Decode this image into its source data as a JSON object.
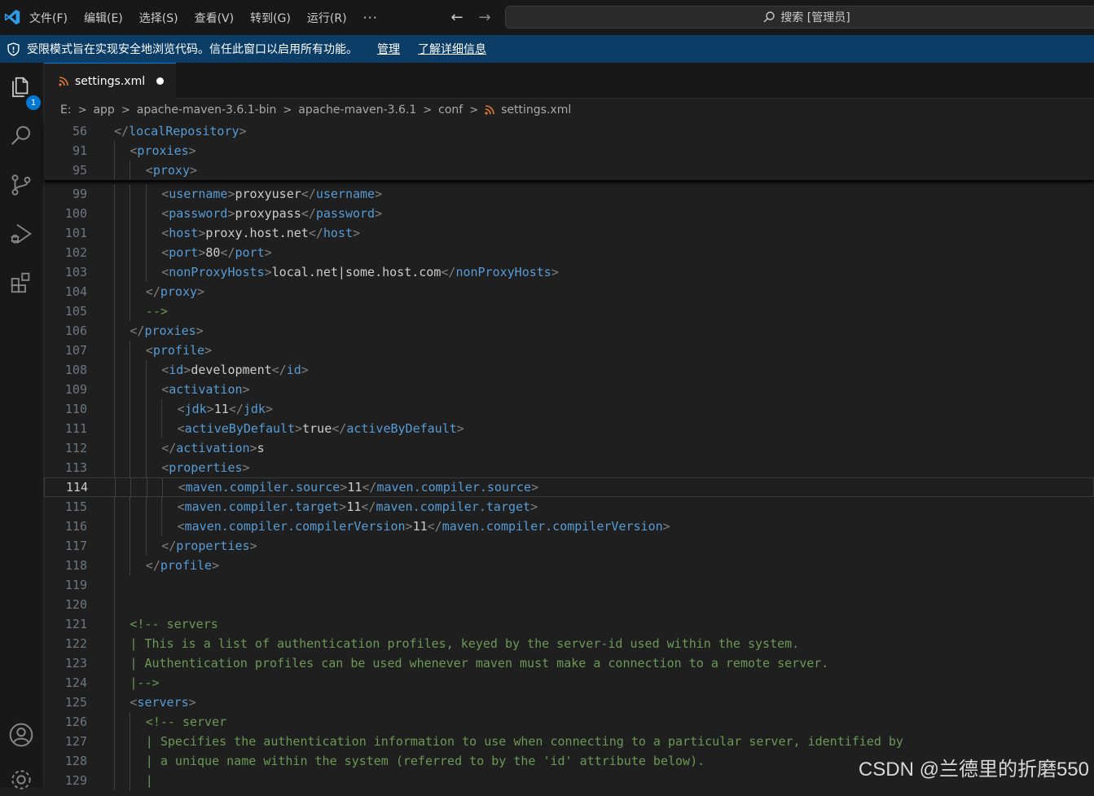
{
  "menu": [
    "文件(F)",
    "编辑(E)",
    "选择(S)",
    "查看(V)",
    "转到(G)",
    "运行(R)",
    "···"
  ],
  "search": {
    "label": "搜索 [管理员]"
  },
  "banner": {
    "text": "受限模式旨在实现安全地浏览代码。信任此窗口以启用所有功能。",
    "manage": "管理",
    "learn_more": "了解详细信息"
  },
  "activity": {
    "explorer_badge": "1"
  },
  "tab": {
    "name": "settings.xml"
  },
  "breadcrumb": [
    "E:",
    "app",
    "apache-maven-3.6.1-bin",
    "apache-maven-3.6.1",
    "conf",
    "settings.xml"
  ],
  "sticky_lines": [
    {
      "n": "56",
      "code": "</localRepository>"
    },
    {
      "n": "91",
      "code": "<proxies>"
    },
    {
      "n": "95",
      "code": "<proxy>"
    }
  ],
  "lines": [
    {
      "n": "99",
      "code": "<username>proxyuser</username>"
    },
    {
      "n": "100",
      "code": "<password>proxypass</password>"
    },
    {
      "n": "101",
      "code": "<host>proxy.host.net</host>"
    },
    {
      "n": "102",
      "code": "<port>80</port>"
    },
    {
      "n": "103",
      "code": "<nonProxyHosts>local.net|some.host.com</nonProxyHosts>"
    },
    {
      "n": "104",
      "code": "</proxy>"
    },
    {
      "n": "105",
      "code": "-->"
    },
    {
      "n": "106",
      "code": "</proxies>"
    },
    {
      "n": "107",
      "code": "<profile>"
    },
    {
      "n": "108",
      "code": "<id>development</id>"
    },
    {
      "n": "109",
      "code": "<activation>"
    },
    {
      "n": "110",
      "code": "<jdk>11</jdk>"
    },
    {
      "n": "111",
      "code": "<activeByDefault>true</activeByDefault>"
    },
    {
      "n": "112",
      "code": "</activation>s"
    },
    {
      "n": "113",
      "code": "<properties>"
    },
    {
      "n": "114",
      "code": "<maven.compiler.source>11</maven.compiler.source>"
    },
    {
      "n": "115",
      "code": "<maven.compiler.target>11</maven.compiler.target>"
    },
    {
      "n": "116",
      "code": "<maven.compiler.compilerVersion>11</maven.compiler.compilerVersion>"
    },
    {
      "n": "117",
      "code": "</properties>"
    },
    {
      "n": "118",
      "code": "</profile>"
    },
    {
      "n": "119",
      "code": ""
    },
    {
      "n": "120",
      "code": ""
    },
    {
      "n": "121",
      "code": "<!-- servers"
    },
    {
      "n": "122",
      "code": "| This is a list of authentication profiles, keyed by the server-id used within the system."
    },
    {
      "n": "123",
      "code": "| Authentication profiles can be used whenever maven must make a connection to a remote server."
    },
    {
      "n": "124",
      "code": "|-->"
    },
    {
      "n": "125",
      "code": "<servers>"
    },
    {
      "n": "126",
      "code": "<!-- server"
    },
    {
      "n": "127",
      "code": "| Specifies the authentication information to use when connecting to a particular server, identified by"
    },
    {
      "n": "128",
      "code": "| a unique name within the system (referred to by the 'id' attribute below)."
    },
    {
      "n": "129",
      "code": "|"
    }
  ],
  "watermark": "CSDN @兰德里的折磨550"
}
